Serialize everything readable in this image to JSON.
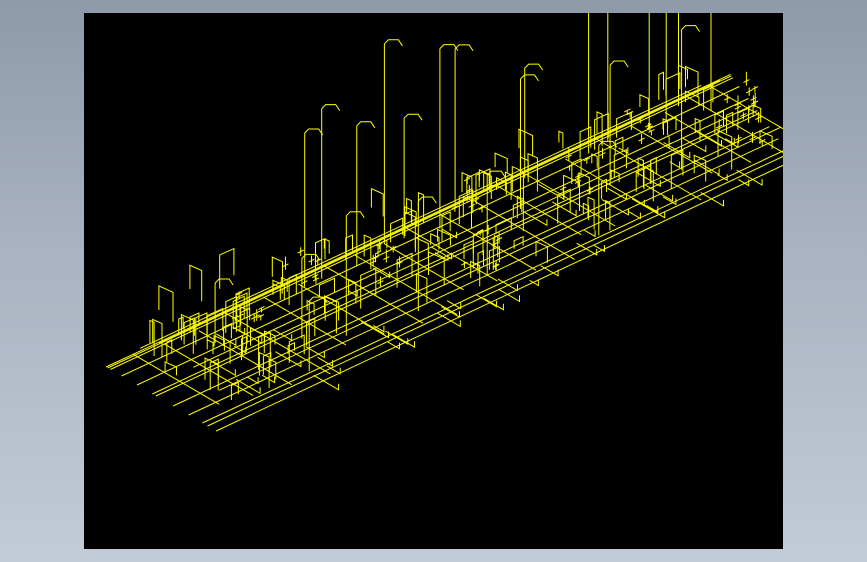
{
  "theme": {
    "background_top": "#8e9aaa",
    "background_bottom": "#c3cbd6",
    "viewport_color": "#000000",
    "line_color": "#ffff00"
  },
  "drawing": {
    "style": "isometric wireframe",
    "subject": "pipe-network-3d-cad"
  }
}
